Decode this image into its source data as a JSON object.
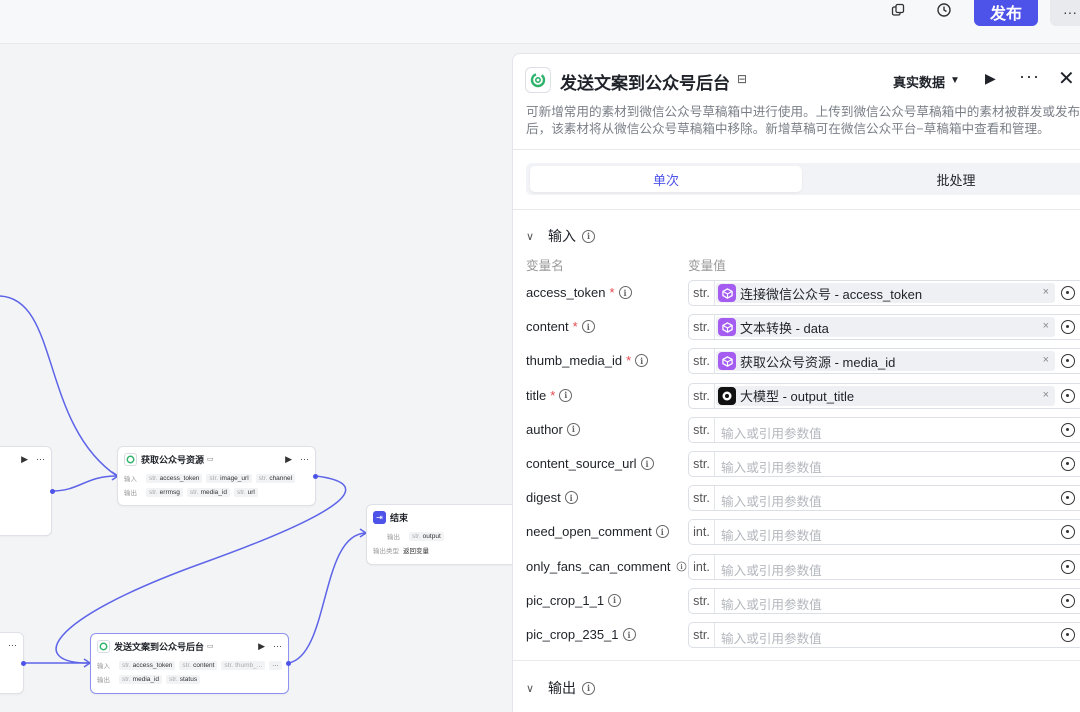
{
  "toolbar": {
    "publish_label": "发布",
    "more_label": "···"
  },
  "canvas": {
    "node_get_resource": {
      "title": "获取公众号资源",
      "input_label": "输入",
      "output_label": "输出",
      "inputs": [
        {
          "type": "str.",
          "name": "access_token"
        },
        {
          "type": "str.",
          "name": "image_url"
        },
        {
          "type": "str.",
          "name": "channel"
        }
      ],
      "outputs": [
        {
          "type": "str.",
          "name": "errmsg"
        },
        {
          "type": "str.",
          "name": "media_id"
        },
        {
          "type": "str.",
          "name": "url"
        }
      ]
    },
    "node_end": {
      "title": "结束",
      "output_label": "输出",
      "outputs": [
        {
          "type": "str.",
          "name": "output"
        }
      ],
      "output_type_label": "输出类型",
      "output_type_value": "返回变量"
    },
    "node_send": {
      "title": "发送文案到公众号后台",
      "input_label": "输入",
      "output_label": "输出",
      "inputs": [
        {
          "type": "str.",
          "name": "access_token"
        },
        {
          "type": "str.",
          "name": "content"
        },
        {
          "type": "str.",
          "name": "thumb_..."
        }
      ],
      "inputs_more": "···",
      "outputs": [
        {
          "type": "str.",
          "name": "media_id"
        },
        {
          "type": "str.",
          "name": "status"
        }
      ]
    },
    "node_ctl": {
      "run": "▶",
      "more": "···"
    }
  },
  "panel": {
    "title": "发送文案到公众号后台",
    "data_mode": "真实数据",
    "description": "可新增常用的素材到微信公众号草稿箱中进行使用。上传到微信公众号草稿箱中的素材被群发或发布后，该素材将从微信公众号草稿箱中移除。新增草稿可在微信公众平台−草稿箱中查看和管理。",
    "tabs": {
      "single": "单次",
      "batch": "批处理"
    },
    "input_section": "输入",
    "output_section": "输出",
    "col_name": "变量名",
    "col_value": "变量值",
    "params": [
      {
        "name": "access_token",
        "required": true,
        "type": "str.",
        "ref_icon": "purple-cube",
        "ref": "连接微信公众号 - access_token"
      },
      {
        "name": "content",
        "required": true,
        "type": "str.",
        "ref_icon": "purple-cube",
        "ref": "文本转换 - data"
      },
      {
        "name": "thumb_media_id",
        "required": true,
        "type": "str.",
        "ref_icon": "purple-cube",
        "ref": "获取公众号资源 - media_id"
      },
      {
        "name": "title",
        "required": true,
        "type": "str.",
        "ref_icon": "llm-model",
        "ref": "大模型 - output_title"
      },
      {
        "name": "author",
        "required": false,
        "type": "str.",
        "placeholder": "输入或引用参数值"
      },
      {
        "name": "content_source_url",
        "required": false,
        "type": "str.",
        "placeholder": "输入或引用参数值"
      },
      {
        "name": "digest",
        "required": false,
        "type": "str.",
        "placeholder": "输入或引用参数值"
      },
      {
        "name": "need_open_comment",
        "required": false,
        "type": "int.",
        "placeholder": "输入或引用参数值"
      },
      {
        "name": "only_fans_can_comment",
        "required": false,
        "type": "int.",
        "placeholder": "输入或引用参数值"
      },
      {
        "name": "pic_crop_1_1",
        "required": false,
        "type": "str.",
        "placeholder": "输入或引用参数值"
      },
      {
        "name": "pic_crop_235_1",
        "required": false,
        "type": "str.",
        "placeholder": "输入或引用参数值"
      }
    ]
  },
  "colors": {
    "accent": "#4d53e8",
    "required": "#e5484d",
    "ref_icon": "#a45df0"
  }
}
